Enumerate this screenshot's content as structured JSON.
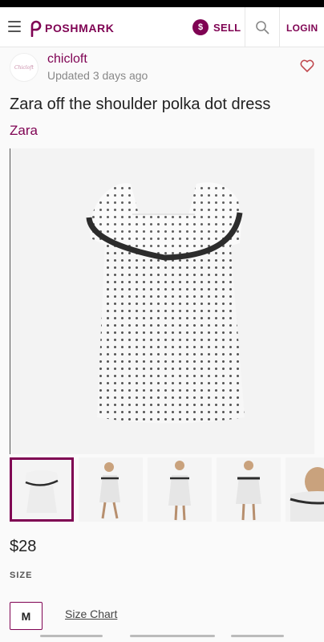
{
  "nav": {
    "brand": "POSHMARK",
    "sell_icon_glyph": "$",
    "sell_label": "SELL",
    "login_label": "LOGIN"
  },
  "seller": {
    "avatar_text": "Chicloft",
    "name": "chicloft",
    "updated": "Updated 3 days ago"
  },
  "listing": {
    "title": "Zara off the shoulder polka dot dress",
    "brand": "Zara",
    "price": "$28",
    "size_heading": "SIZE",
    "size_value": "M",
    "size_chart_label": "Size Chart"
  },
  "colors": {
    "accent": "#7f0353",
    "text": "#222222",
    "muted": "#888888",
    "background": "#fafafa"
  },
  "icons": [
    "hamburger-menu-icon",
    "poshmark-logo-icon",
    "sell-dollar-icon",
    "search-icon",
    "heart-icon"
  ]
}
